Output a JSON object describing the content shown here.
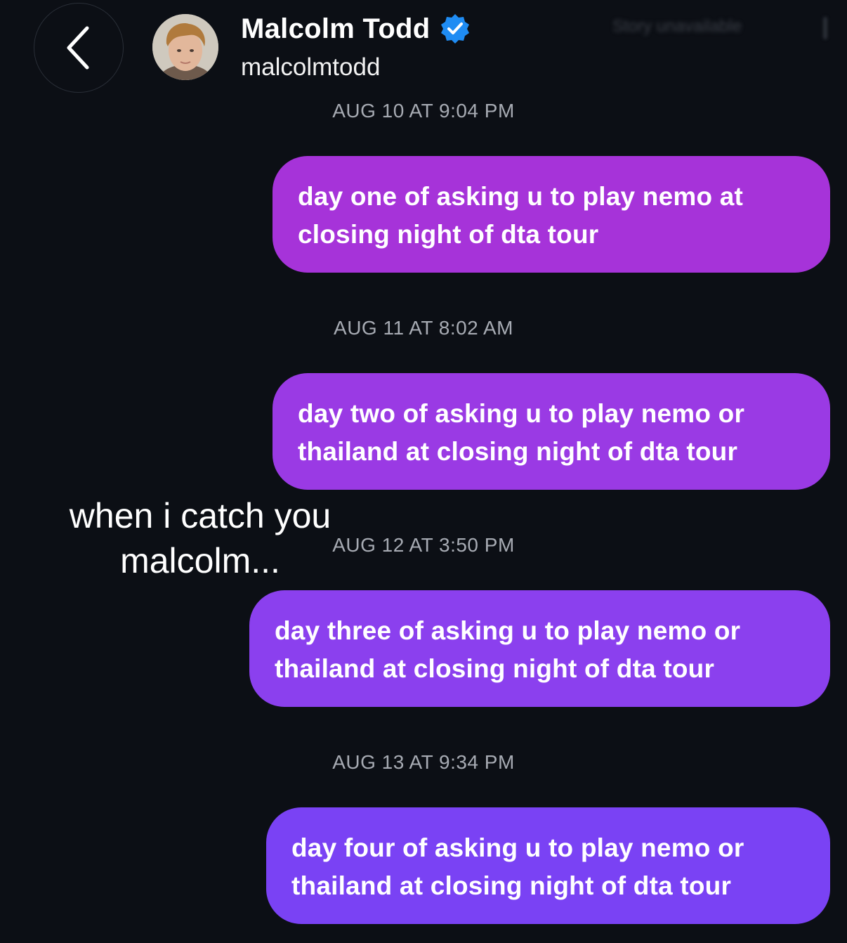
{
  "header": {
    "name": "Malcolm Todd",
    "handle": "malcolmtodd",
    "story_status": "Story unavailable",
    "icons": {
      "back": "chevron-left-icon",
      "verified": "verified-badge-icon"
    },
    "colors": {
      "verified": "#1f8cf3",
      "background": "#0c0f15"
    }
  },
  "messages": [
    {
      "timestamp": "AUG 10 AT 9:04 PM",
      "text": "day one of asking u to play nemo at closing night of dta tour"
    },
    {
      "timestamp": "AUG 11 AT 8:02 AM",
      "text": "day two of asking u to play nemo or thailand at closing night of dta tour"
    },
    {
      "timestamp": "AUG 12 AT 3:50 PM",
      "text": "day three of asking u to play nemo or thailand at closing night of dta tour"
    },
    {
      "timestamp": "AUG 13 AT 9:34 PM",
      "text": "day four of asking u to play nemo or thailand at closing night of dta tour"
    }
  ],
  "bubble_colors": [
    "#a633d9",
    "#9a3ae4",
    "#8b40ee",
    "#7a42f4"
  ],
  "overlay_caption": "when i catch you malcolm..."
}
